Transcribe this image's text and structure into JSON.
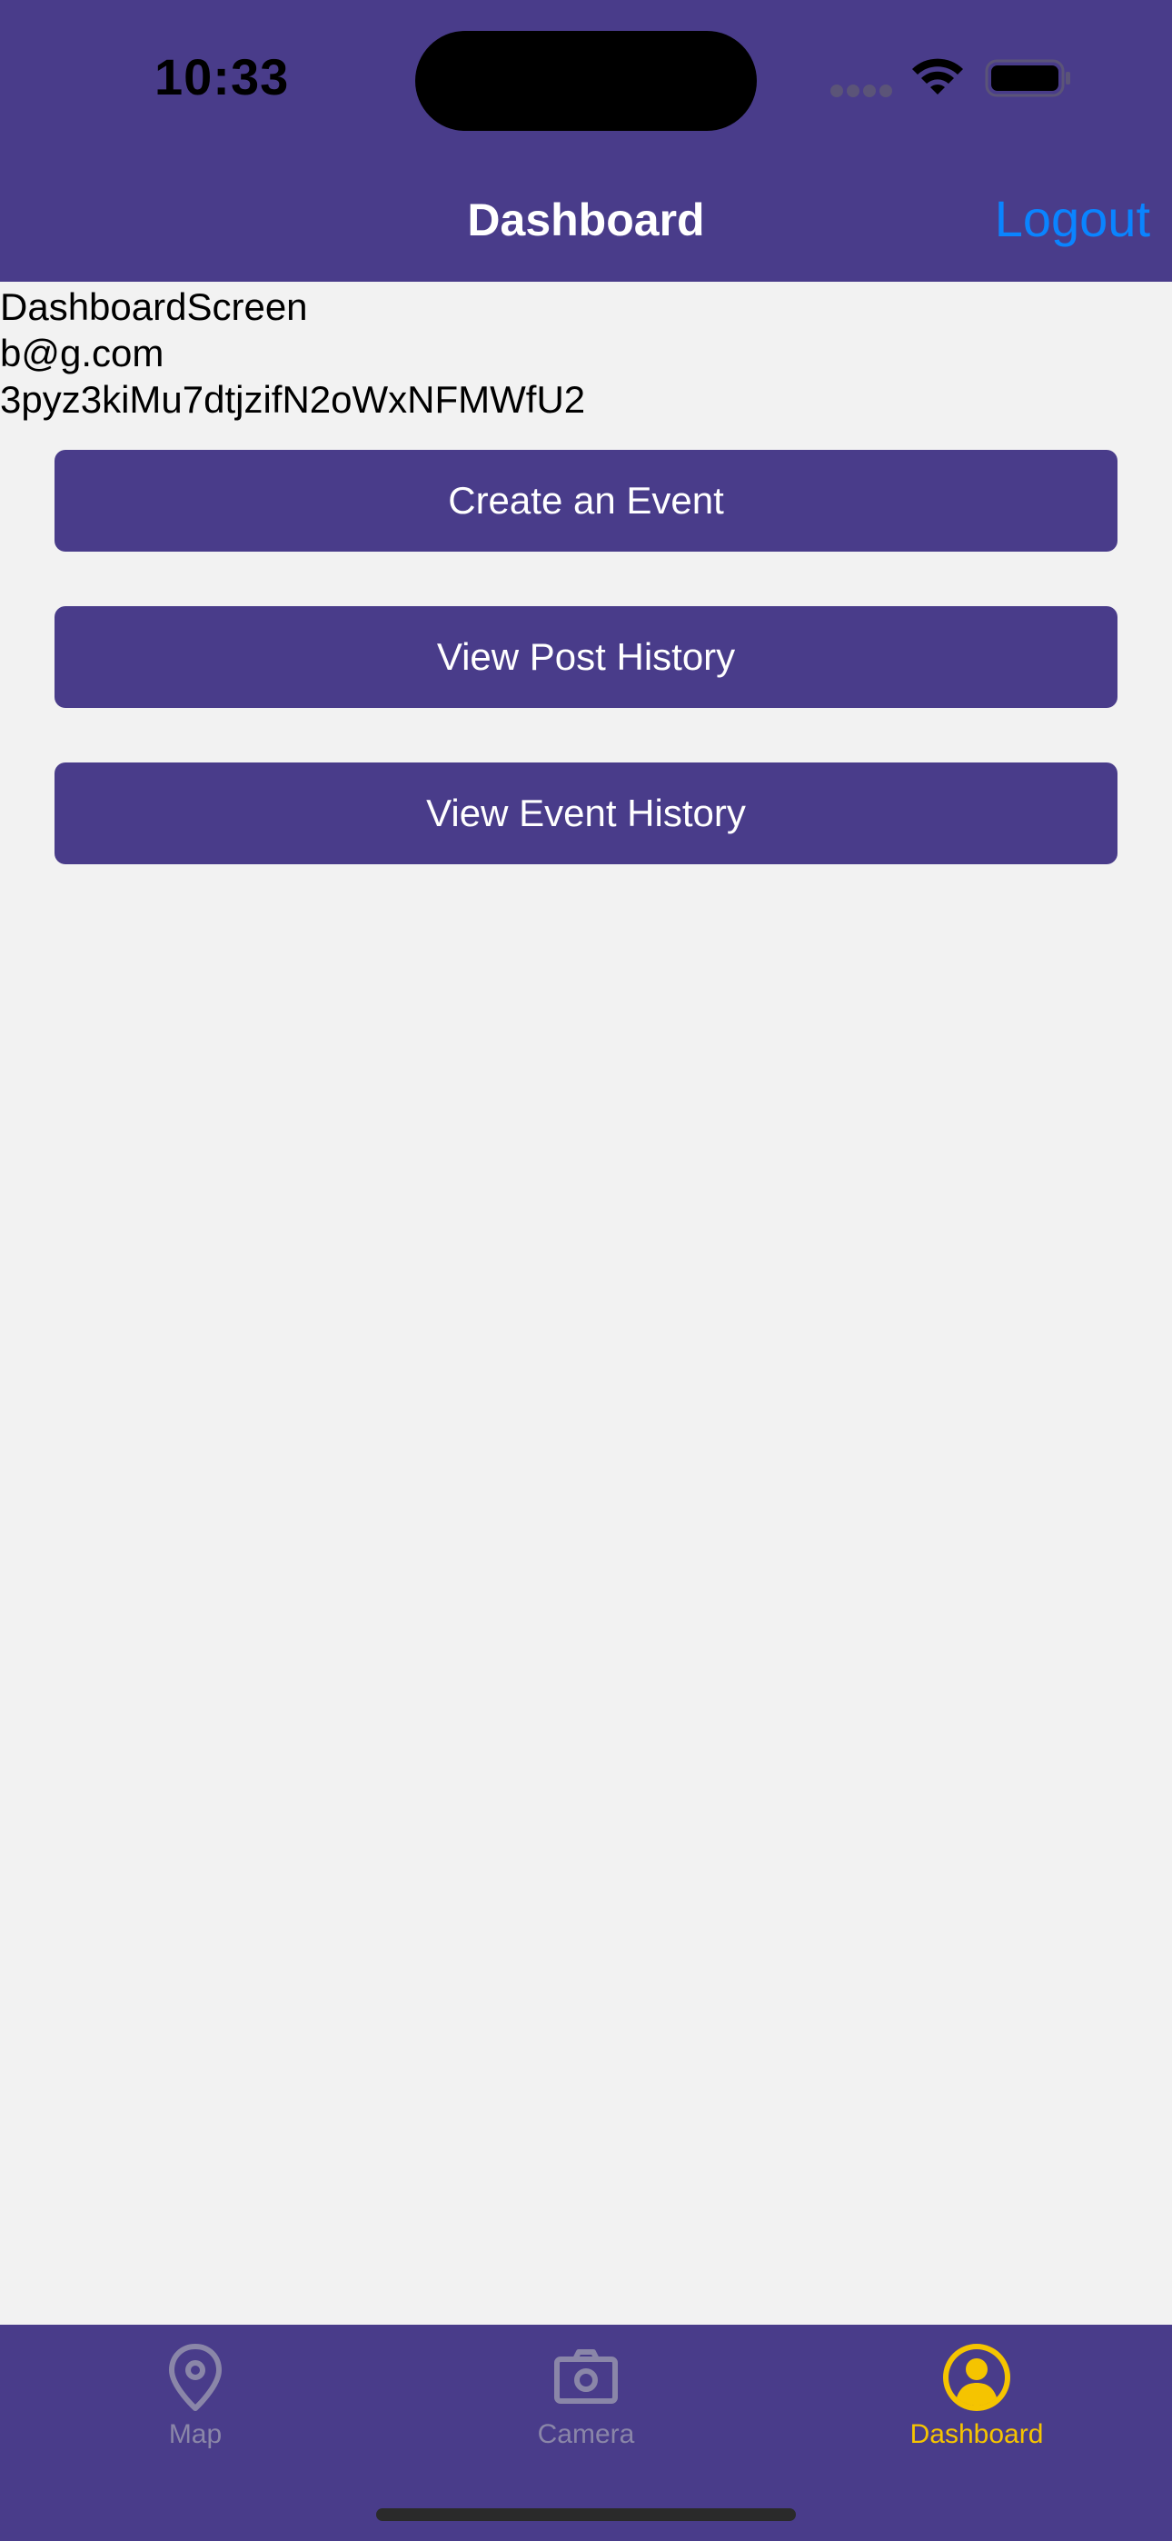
{
  "status_bar": {
    "time": "10:33"
  },
  "nav": {
    "title": "Dashboard",
    "logout_label": "Logout"
  },
  "info": {
    "screen_name": "DashboardScreen",
    "email": "b@g.com",
    "user_id": "3pyz3kiMu7dtjzifN2oWxNFMWfU2"
  },
  "buttons": {
    "create_event": "Create an Event",
    "view_post_history": "View Post History",
    "view_event_history": "View Event History"
  },
  "tabs": [
    {
      "label": "Map",
      "icon": "map-pin-icon",
      "active": false
    },
    {
      "label": "Camera",
      "icon": "camera-icon",
      "active": false
    },
    {
      "label": "Dashboard",
      "icon": "user-circle-icon",
      "active": true
    }
  ],
  "colors": {
    "brand_purple": "#493c8a",
    "background": "#f2f2f2",
    "logout_blue": "#0a84ff",
    "active_tab": "#f5c400",
    "inactive_tab": "#8a86a8"
  }
}
